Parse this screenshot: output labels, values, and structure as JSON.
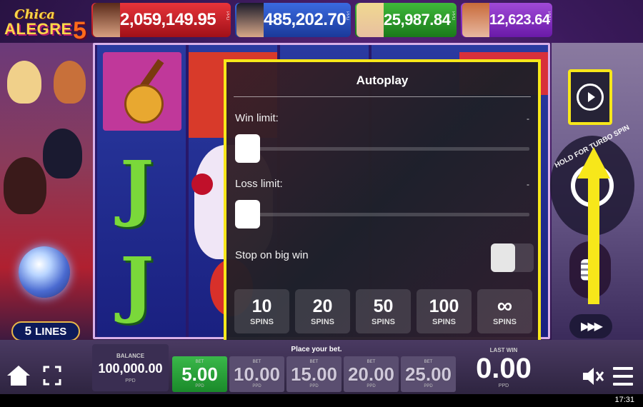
{
  "logo": {
    "line1": "Chica",
    "line2": "ALEGRE",
    "line3": "5"
  },
  "jackpots": [
    {
      "value": "2,059,149.95",
      "currency": "PPD",
      "color": "#c8202a"
    },
    {
      "value": "485,202.70",
      "currency": "PPD",
      "color": "#2a50c0"
    },
    {
      "value": "25,987.84",
      "currency": "PPD",
      "color": "#2a982a"
    },
    {
      "value": "12,623.64",
      "currency": "PPD",
      "color": "#8a32c0"
    }
  ],
  "lines_badge": {
    "count": "5",
    "label": "LINES"
  },
  "autoplay": {
    "title": "Autoplay",
    "win_limit": {
      "label": "Win limit:",
      "value": "-"
    },
    "loss_limit": {
      "label": "Loss limit:",
      "value": "-"
    },
    "stop_on_big_win": {
      "label": "Stop on big win"
    },
    "spin_options": [
      {
        "value": "10",
        "unit": "SPINS"
      },
      {
        "value": "20",
        "unit": "SPINS"
      },
      {
        "value": "50",
        "unit": "SPINS"
      },
      {
        "value": "100",
        "unit": "SPINS"
      },
      {
        "value": "∞",
        "unit": "SPINS"
      }
    ]
  },
  "spin_button": {
    "hint": "HOLD FOR TURBO SPIN"
  },
  "turbo_button": {
    "glyph": "▶▶▶"
  },
  "footer": {
    "balance": {
      "caption": "BALANCE",
      "amount": "100,000.00",
      "currency": "PPD"
    },
    "place_bet": "Place your bet.",
    "bets": [
      {
        "caption": "BET",
        "amount": "5.00",
        "currency": "PPD",
        "active": true
      },
      {
        "caption": "BET",
        "amount": "10.00",
        "currency": "PPD"
      },
      {
        "caption": "BET",
        "amount": "15.00",
        "currency": "PPD"
      },
      {
        "caption": "BET",
        "amount": "20.00",
        "currency": "PPD"
      },
      {
        "caption": "BET",
        "amount": "25.00",
        "currency": "PPD"
      }
    ],
    "last_win": {
      "caption": "LAST WIN",
      "amount": "0.00",
      "currency": "PPD"
    }
  },
  "status_bar": {
    "time": "17:31"
  },
  "colors": {
    "highlight": "#f7e71a",
    "active_bet": "#2aa83a"
  },
  "icons": [
    "home-icon",
    "fullscreen-icon",
    "mute-icon",
    "menu-icon",
    "autoplay-icon",
    "spin-icon",
    "coins-icon",
    "turbo-icon",
    "arrow-up-icon"
  ]
}
